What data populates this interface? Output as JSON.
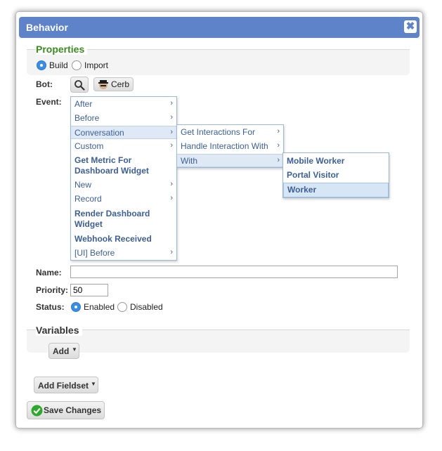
{
  "dialog": {
    "title": "Behavior",
    "close_label": "✖"
  },
  "properties": {
    "legend": "Properties",
    "mode_options": [
      "Build",
      "Import"
    ],
    "mode_selected": "Build",
    "bot_label": "Bot:",
    "bot_name": "Cerb",
    "event_label": "Event:"
  },
  "event_menu": {
    "level1": [
      {
        "label": "After",
        "submenu": true
      },
      {
        "label": "Before",
        "submenu": true
      },
      {
        "label": "Conversation",
        "submenu": true,
        "highlighted": true
      },
      {
        "label": "Custom",
        "submenu": true
      },
      {
        "label": "Get Metric For Dashboard Widget",
        "bold": true
      },
      {
        "label": "New",
        "submenu": true
      },
      {
        "label": "Record",
        "submenu": true
      },
      {
        "label": "Render Dashboard Widget",
        "bold": true
      },
      {
        "label": "Webhook Received",
        "bold": true
      },
      {
        "label": "[UI] Before",
        "submenu": true
      }
    ],
    "level1_line2": {
      "item4": "Dashboard Widget",
      "item7": "Widget"
    },
    "level1_line1": {
      "item4": "Get Metric For",
      "item7": "Render Dashboard"
    },
    "level2": [
      {
        "label": "Get Interactions For",
        "submenu": true
      },
      {
        "label": "Handle Interaction With",
        "submenu": true
      },
      {
        "label": "With",
        "submenu": true,
        "highlighted": true
      }
    ],
    "level3": [
      {
        "label": "Mobile Worker"
      },
      {
        "label": "Portal Visitor"
      },
      {
        "label": "Worker",
        "selected": true
      }
    ],
    "arrow_glyph": "›"
  },
  "fields": {
    "name_label": "Name:",
    "name_value": "",
    "priority_label": "Priority:",
    "priority_value": "50",
    "status_label": "Status:",
    "status_options": [
      "Enabled",
      "Disabled"
    ],
    "status_selected": "Enabled"
  },
  "variables": {
    "legend": "Variables",
    "add_label": "Add"
  },
  "footer": {
    "add_fieldset_label": "Add Fieldset",
    "save_label": "Save Changes"
  },
  "colors": {
    "titlebar": "#5e83c9",
    "properties_legend": "#3b8a1f",
    "menu_text": "#3b5f96",
    "save_check": "#2ea82e"
  },
  "icons": {
    "close": "close-icon",
    "search": "search-icon",
    "bot_avatar": "bot-avatar-icon",
    "check": "check-circle-icon",
    "caret": "caret-down-icon"
  }
}
